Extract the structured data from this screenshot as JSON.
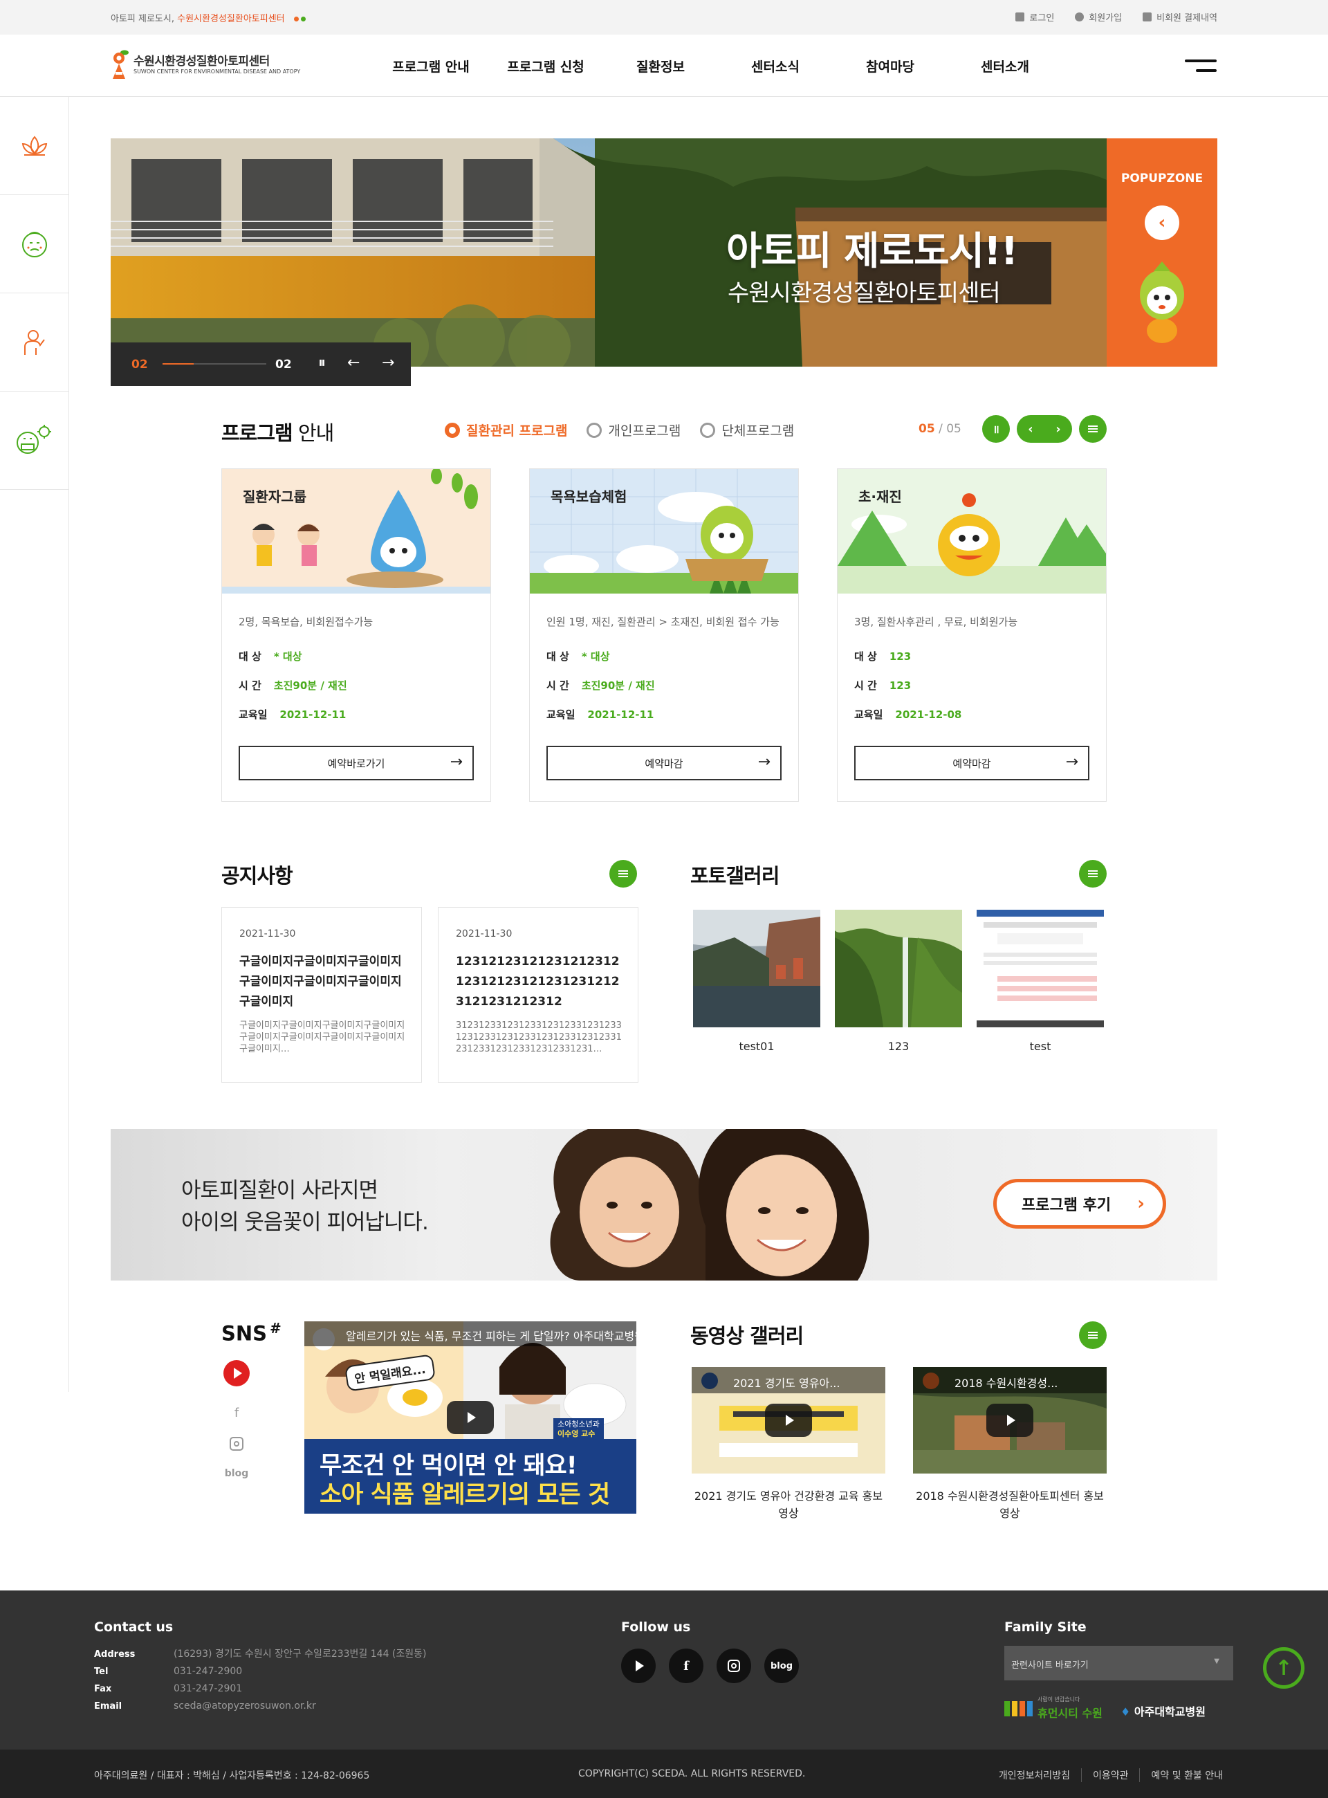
{
  "topbar": {
    "slogan_prefix": "아토피 제로도시,",
    "slogan_highlight": "수원시환경성질환아토피센터",
    "links": [
      {
        "label": "로그인",
        "icon": "lock-icon"
      },
      {
        "label": "회원가입",
        "icon": "user-icon"
      },
      {
        "label": "비회원 결제내역",
        "icon": "receipt-icon"
      }
    ]
  },
  "header": {
    "logo_title": "수원시환경성질환아토피센터",
    "logo_subtitle": "SUWON CENTER FOR ENVIRONMENTAL DISEASE AND ATOPY",
    "nav": [
      "프로그램 안내",
      "프로그램 신청",
      "질환정보",
      "센터소식",
      "참여마당",
      "센터소개"
    ]
  },
  "quick_menu": [
    "lotus-icon",
    "atopy-face-icon",
    "allergy-body-icon",
    "mask-virus-icon"
  ],
  "visual": {
    "title": "아토피 제로도시!!",
    "subtitle": "수원시환경성질환아토피센터",
    "current": "02",
    "total": "02",
    "progress": 0.3,
    "popup_label": "POPUPZONE"
  },
  "programs": {
    "title_bold": "프로그램",
    "title_rest": " 안내",
    "tabs": [
      {
        "label": "질환관리 프로그램",
        "active": true
      },
      {
        "label": "개인프로그램",
        "active": false
      },
      {
        "label": "단체프로그램",
        "active": false
      }
    ],
    "page_current": "05",
    "page_sep": " / ",
    "page_total": "05",
    "cards": [
      {
        "title": "질환자그룹",
        "desc": "2명, 목욕보습, 비회원접수가능",
        "target_label": "대 상",
        "target": "* 대상",
        "time_label": "시 간",
        "time": "초진90분 / 재진",
        "date_label": "교육일",
        "date": "2021-12-11",
        "button": "예약바로가기"
      },
      {
        "title": "목욕보습체험",
        "desc": "인원 1명, 재진, 질환관리 > 초재진, 비회원 접수 가능",
        "target_label": "대 상",
        "target": "* 대상",
        "time_label": "시 간",
        "time": "초진90분 / 재진",
        "date_label": "교육일",
        "date": "2021-12-11",
        "button": "예약마감"
      },
      {
        "title": "초·재진",
        "desc": "3명, 질환사후관리 , 무료, 비회원가능",
        "target_label": "대 상",
        "target": "123",
        "time_label": "시 간",
        "time": "123",
        "date_label": "교육일",
        "date": "2021-12-08",
        "button": "예약마감"
      }
    ]
  },
  "notice": {
    "title": "공지사항",
    "items": [
      {
        "date": "2021-11-30",
        "title": "구글이미지구글이미지구글이미지구글이미지구글이미지구글이미지구글이미지",
        "body": "구글이미지구글이미지구글이미지구글이미지구글이미지구글이미지구글이미지구글이미지구글이미지…"
      },
      {
        "date": "2021-11-30",
        "title": "12312123121231212312123121231212312312123121231212312",
        "body": "3123123312312331231233123123312312331231233123123312312331231233123123312312331231…"
      }
    ]
  },
  "gallery": {
    "title": "포토갤러리",
    "items": [
      {
        "caption": "test01"
      },
      {
        "caption": "123"
      },
      {
        "caption": "test"
      }
    ]
  },
  "banner": {
    "line1": "아토피질환이 사라지면",
    "line2": "아이의 웃음꽃이 피어납니다.",
    "button": "프로그램 후기"
  },
  "sns": {
    "title": "SNS",
    "sup": "#",
    "links": [
      {
        "name": "youtube-icon"
      },
      {
        "label": "f"
      },
      {
        "name": "instagram-icon"
      },
      {
        "label": "blog"
      }
    ],
    "video_title": "알레르기가 있는 식품, 무조건 피하는 게 답일까? 아주대학교병원TV",
    "video_caption1": "무조건 안 먹이면 안 돼요!",
    "video_caption2": "소아 식품 알레르기의 모든 것",
    "video_sticker": "안 먹일래요...",
    "doctor_label": "소아청소년과",
    "doctor_name": "이수영 교수"
  },
  "videos": {
    "title": "동영상 갤러리",
    "items": [
      {
        "thumb_title": "2021 경기도 영유아...",
        "caption": "2021 경기도 영유아 건강환경 교육 홍보 영상"
      },
      {
        "thumb_title": "2018 수원시환경성...",
        "caption": "2018 수원시환경성질환아토피센터 홍보영상"
      }
    ]
  },
  "footer": {
    "contact_title": "Contact us",
    "contact": [
      {
        "k": "Address",
        "v": "(16293) 경기도 수원시 장안구 수일로233번길 144 (조원동)"
      },
      {
        "k": "Tel",
        "v": "031-247-2900"
      },
      {
        "k": "Fax",
        "v": "031-247-2901"
      },
      {
        "k": "Email",
        "v": "sceda@atopyzerosuwon.or.kr"
      }
    ],
    "follow_title": "Follow us",
    "follow_blog": "blog",
    "family_title": "Family Site",
    "family_select": "관련사이트 바로가기",
    "family_logo1_small": "사람이 반갑습니다",
    "family_logo1": "휴먼시티 수원",
    "family_logo2": "아주대학교병원",
    "copy_left": "아주대의료원 / 대표자 : 박해심 / 사업자등록번호 : 124-82-06965",
    "copy_center": "COPYRIGHT(C) SCEDA. ALL RIGHTS RESERVED.",
    "copy_links": [
      "개인정보처리방침",
      "이용약관",
      "예약 및 환불 안내"
    ]
  },
  "colors": {
    "accent": "#ef6a27",
    "green": "#4aab1d",
    "footer": "#333333"
  }
}
